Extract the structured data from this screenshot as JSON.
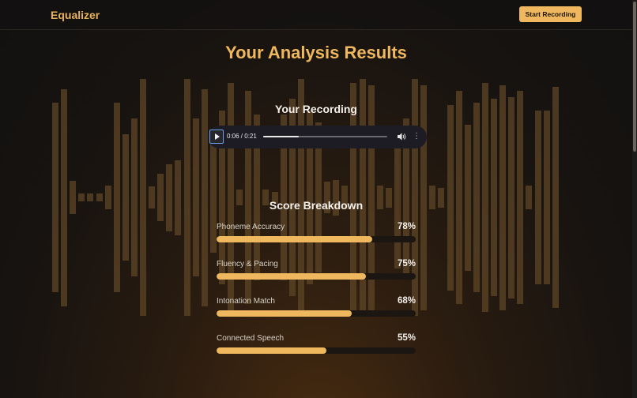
{
  "header": {
    "brand": "Equalizer",
    "cta_label": "Start Recording",
    "accent_color": "#f0b85e"
  },
  "page": {
    "title": "Your Analysis Results"
  },
  "recording": {
    "heading": "Your Recording",
    "time_display": "0:06 / 0:21",
    "current_seconds": 6,
    "duration_seconds": 21,
    "icons": [
      "play-icon",
      "volume-icon",
      "more-options-icon"
    ]
  },
  "scores": {
    "heading": "Score Breakdown",
    "items": [
      {
        "label": "Phoneme Accuracy",
        "percent_text": "78%",
        "value": 78
      },
      {
        "label": "Fluency & Pacing",
        "percent_text": "75%",
        "value": 75
      },
      {
        "label": "Intonation Match",
        "percent_text": "68%",
        "value": 68
      },
      {
        "label": "Connected Speech",
        "percent_text": "55%",
        "value": 55
      }
    ]
  }
}
